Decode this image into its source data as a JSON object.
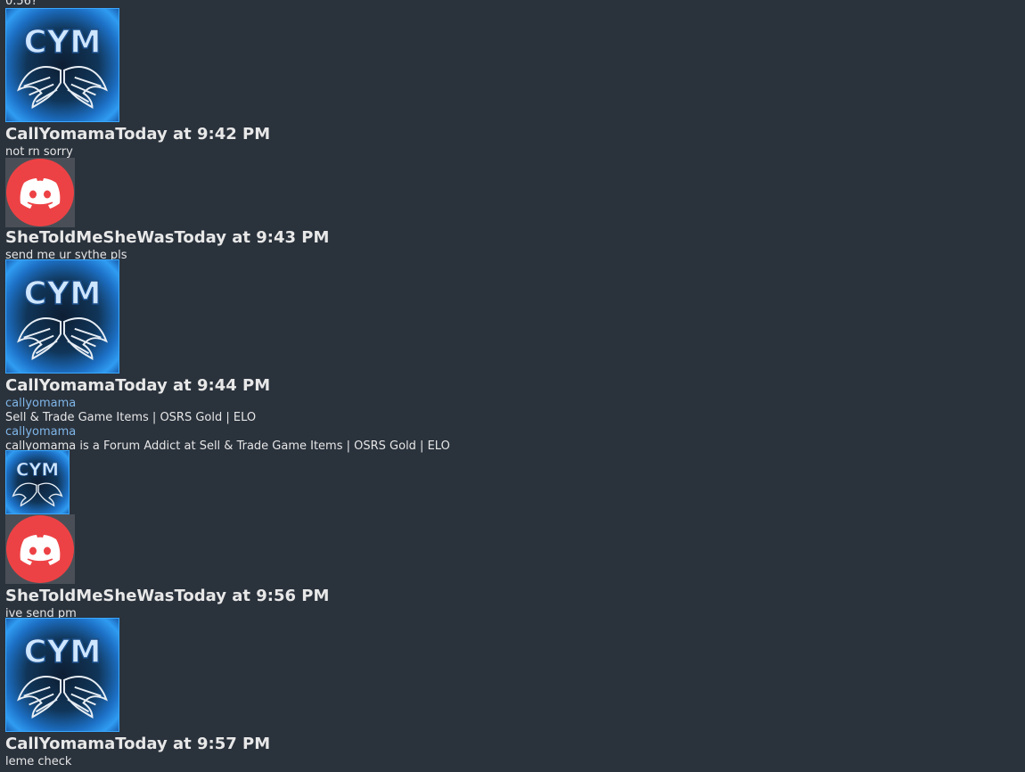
{
  "colors": {
    "background": "#2a323c",
    "text": "#e6e6e6",
    "link": "#7fb6e8",
    "discord_red": "#ed4245",
    "cym_border": "#39a8ff"
  },
  "top_fragment": "0.56?",
  "messages": [
    {
      "avatar": "cym-avatar",
      "avatar_text": "CYM",
      "author": "CallYomama",
      "timestamp": "Today at 9:42 PM",
      "body": "not rn sorry"
    },
    {
      "avatar": "discord-avatar",
      "author": "SheToldMeSheWas",
      "timestamp": "Today at 9:43 PM",
      "body": "send me ur sythe pls"
    },
    {
      "avatar": "cym-avatar",
      "avatar_text": "CYM",
      "author": "CallYomama",
      "timestamp": "Today at 9:44 PM",
      "embed": {
        "site_name": "callyomama",
        "site_desc": "Sell & Trade Game Items | OSRS Gold | ELO",
        "title": "callyomama",
        "description": "callyomama is a Forum Addict at Sell & Trade Game Items | OSRS Gold | ELO",
        "thumbnail_text": "CYM"
      }
    },
    {
      "avatar": "discord-avatar",
      "author": "SheToldMeSheWas",
      "timestamp": "Today at 9:56 PM",
      "body": "ive send pm"
    },
    {
      "avatar": "cym-avatar",
      "avatar_text": "CYM",
      "author": "CallYomama",
      "timestamp": "Today at 9:57 PM",
      "body": "leme check"
    }
  ]
}
